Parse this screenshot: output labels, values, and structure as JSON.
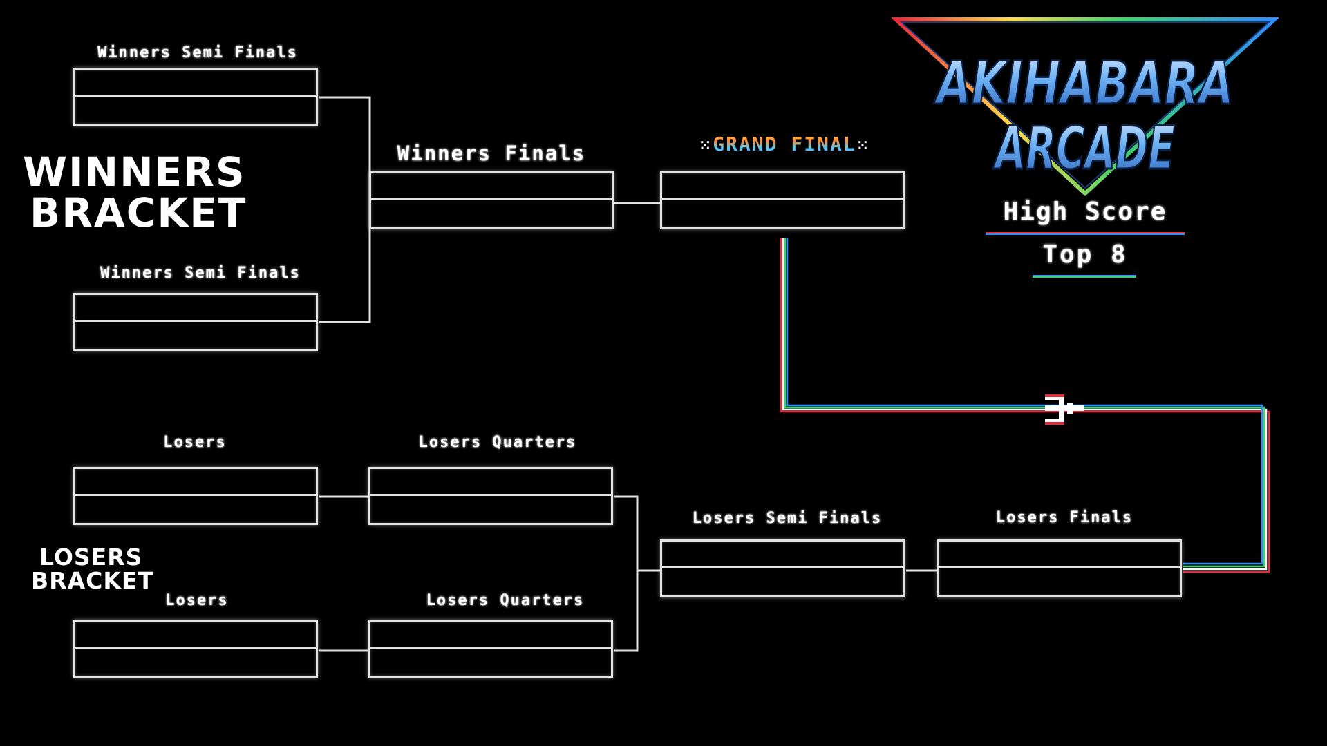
{
  "logo": {
    "line1": "AKIHABARA",
    "line2": "ARCADE"
  },
  "event": {
    "subtitle": "High Score",
    "tagline": "Top 8"
  },
  "sections": {
    "winners": [
      "WINNERS",
      "BRACKET"
    ],
    "losers": [
      "LOSERS",
      "BRACKET"
    ]
  },
  "matches": {
    "winners_semi_1": "Winners Semi Finals",
    "winners_semi_2": "Winners Semi Finals",
    "winners_finals": "Winners Finals",
    "grand_final": "GRAND FINAL",
    "losers_1": "Losers",
    "losers_2": "Losers",
    "losers_quarters_1": "Losers Quarters",
    "losers_quarters_2": "Losers Quarters",
    "losers_semi": "Losers Semi Finals",
    "losers_finals": "Losers Finals"
  },
  "colors": {
    "frame": "#e2e2e2",
    "rainbow": [
      "#e8283a",
      "#f6f6f6",
      "#3fd36b",
      "#2f8dff"
    ],
    "logo_blue": "#4a90e8",
    "underline_red": "#e8283a",
    "underline_blue": "#2f8dff"
  }
}
